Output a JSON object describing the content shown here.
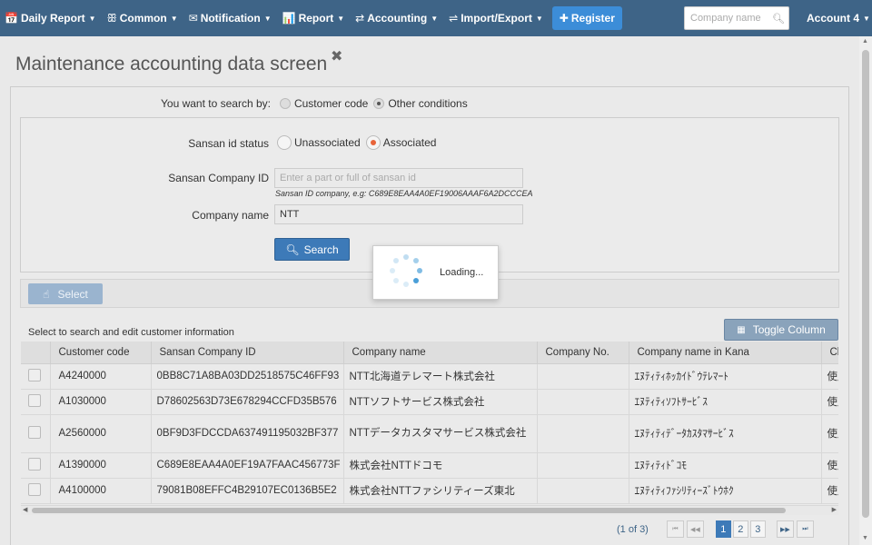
{
  "navbar": {
    "items": [
      {
        "icon": "📅",
        "label": "Daily Report"
      },
      {
        "icon": "ꕥ",
        "label": "Common"
      },
      {
        "icon": "✉",
        "label": "Notification"
      },
      {
        "icon": "📊",
        "label": "Report"
      },
      {
        "icon": "⇄",
        "label": "Accounting"
      },
      {
        "icon": "⇌",
        "label": "Import/Export"
      }
    ],
    "register_label": "Register",
    "register_icon": "✚",
    "search_placeholder": "Company name",
    "account_label": "Account 4"
  },
  "page": {
    "title": "Maintenance accounting data screen",
    "close_glyph": "✖"
  },
  "search_by": {
    "label": "You want to search by:",
    "options": [
      "Customer code",
      "Other conditions"
    ],
    "selected": "Other conditions"
  },
  "form": {
    "status_label": "Sansan id status",
    "status_options": [
      "Unassociated",
      "Associated"
    ],
    "status_selected": "Associated",
    "sansan_id_label": "Sansan Company ID",
    "sansan_id_placeholder": "Enter a part or full of sansan id",
    "sansan_id_value": "",
    "sansan_id_hint": "Sansan ID company, e.g: C689E8EAA4A0EF19006AAAF6A2DCCCEA",
    "company_name_label": "Company name",
    "company_name_value": "NTT",
    "search_button": "Search"
  },
  "loading": {
    "text": "Loading..."
  },
  "select_button": "Select",
  "table": {
    "caption": "Select to search and edit customer information",
    "toggle_column_button": "Toggle Column",
    "headers": [
      "",
      "Customer code",
      "Sansan Company ID",
      "Company name",
      "Company No.",
      "Company name in Kana",
      "Clie"
    ],
    "rows": [
      {
        "code": "A4240000",
        "sansan_id": "0BB8C71A8BA03DD2518575C46FF93",
        "name": "NTT北海道テレマート株式会社",
        "no": "",
        "kana": "ｴﾇﾃｨﾃｨﾎｯｶｲﾄﾞｳﾃﾚﾏｰﾄ",
        "client": "使用"
      },
      {
        "code": "A1030000",
        "sansan_id": "D78602563D73E678294CCFD35B576",
        "name": "NTTソフトサービス株式会社",
        "no": "",
        "kana": "ｴﾇﾃｨﾃｨｿﾌﾄｻｰﾋﾞｽ",
        "client": "使用"
      },
      {
        "code": "A2560000",
        "sansan_id": "0BF9D3FDCCDA637491195032BF377",
        "name": "NTTデータカスタマサービス株式会社",
        "no": "",
        "kana": "ｴﾇﾃｨﾃｨﾃﾞｰﾀｶｽﾀﾏｻｰﾋﾞｽ",
        "client": "使用"
      },
      {
        "code": "A1390000",
        "sansan_id": "C689E8EAA4A0EF19A7FAAC456773F",
        "name": "株式会社NTTドコモ",
        "no": "",
        "kana": "ｴﾇﾃｨﾃｨﾄﾞｺﾓ",
        "client": "使用"
      },
      {
        "code": "A4100000",
        "sansan_id": "79081B08EFFC4B29107EC0136B5E2",
        "name": "株式会社NTTファシリティーズ東北",
        "no": "",
        "kana": "ｴﾇﾃｨﾃｨﾌｧｼﾘﾃｨｰｽﾞﾄｳﾎｸ",
        "client": "使用"
      }
    ]
  },
  "pager": {
    "info": "(1 of 3)",
    "pages": [
      "1",
      "2",
      "3"
    ],
    "current": "1",
    "first": "⏮",
    "prev": "◀◀",
    "next": "▶▶",
    "last": "⏭"
  },
  "colors": {
    "navbar": "#3e6487",
    "primary": "#3d7ab8",
    "radio_checked": "#e8643a"
  }
}
